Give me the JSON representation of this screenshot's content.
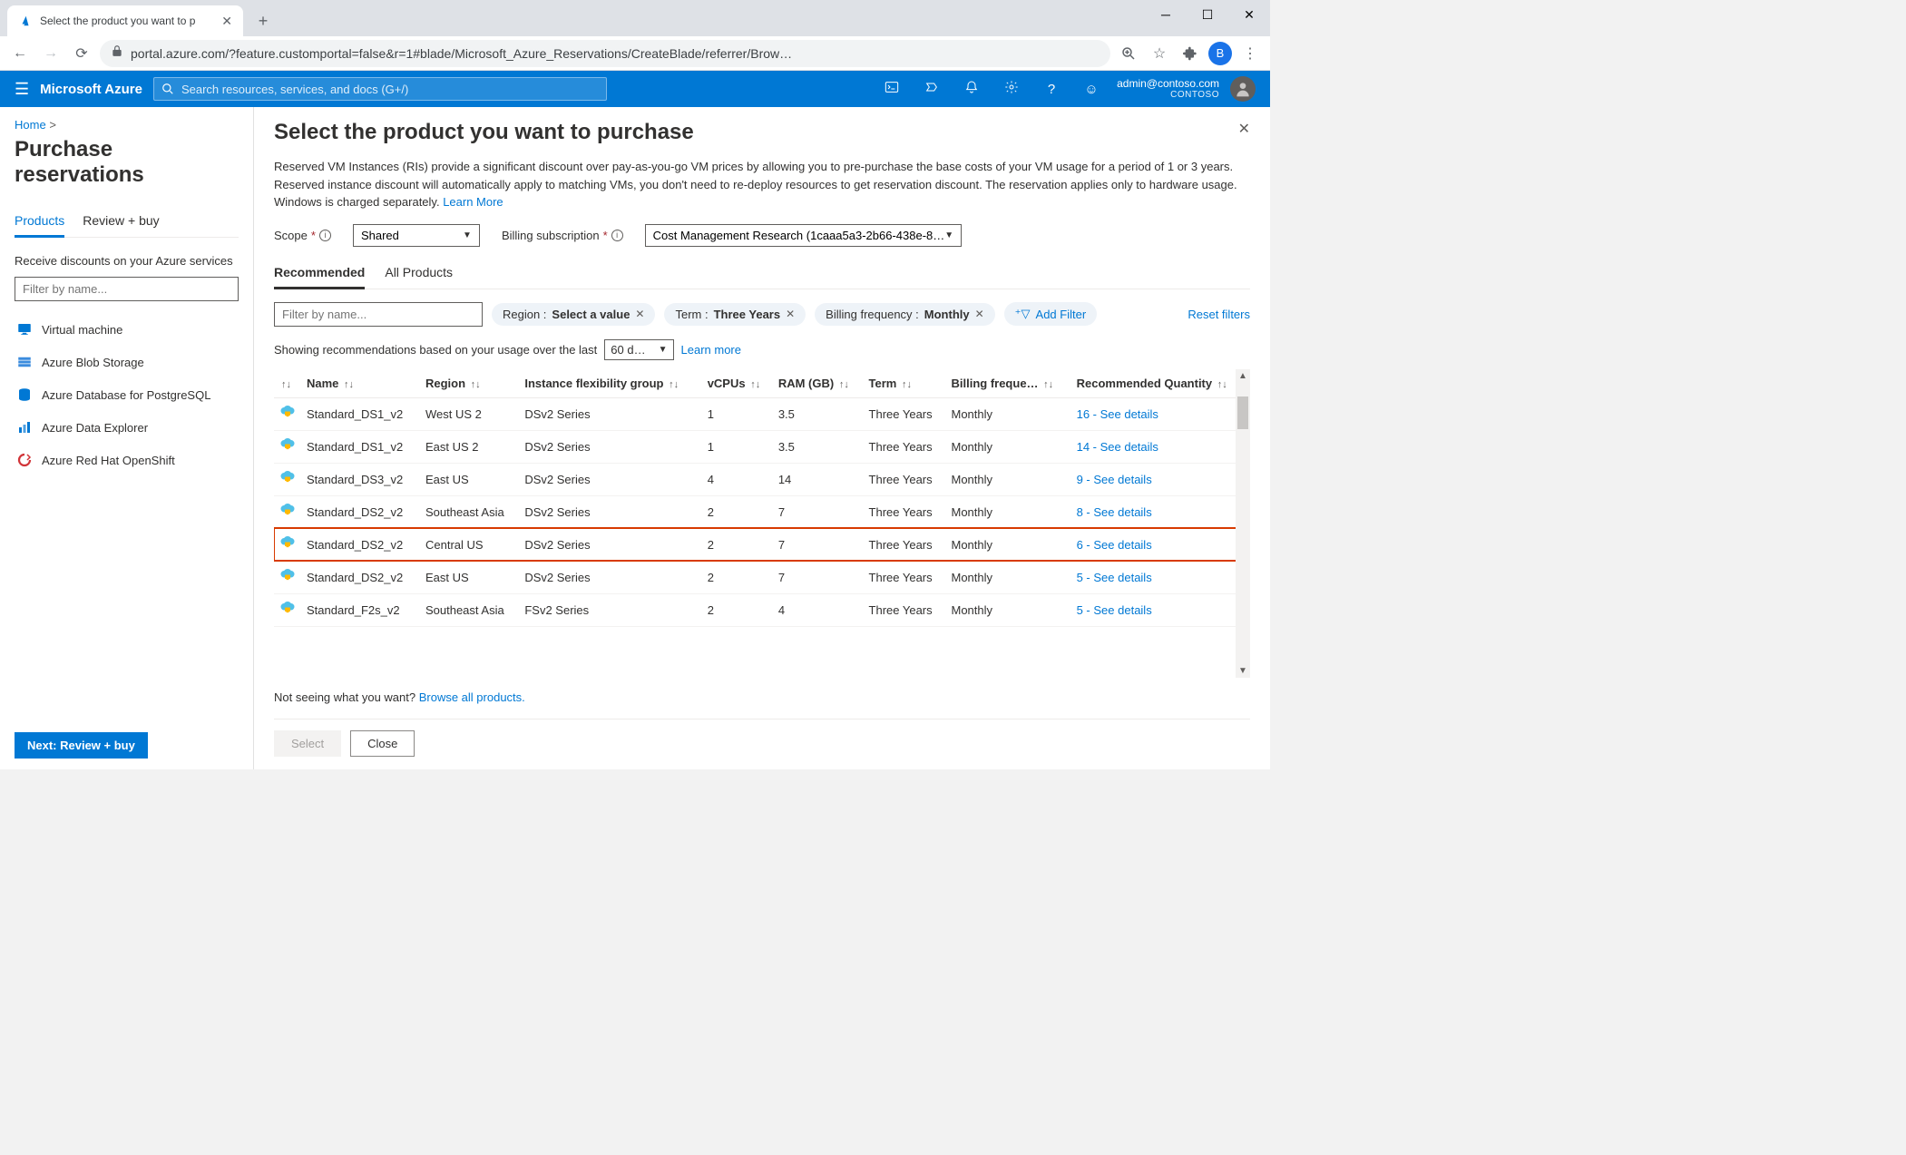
{
  "browser": {
    "tab_title": "Select the product you want to p",
    "url": "portal.azure.com/?feature.customportal=false&r=1#blade/Microsoft_Azure_Reservations/CreateBlade/referrer/Brow…",
    "profile_initial": "B"
  },
  "azure_header": {
    "brand": "Microsoft Azure",
    "search_placeholder": "Search resources, services, and docs (G+/)",
    "user_email": "admin@contoso.com",
    "tenant": "CONTOSO"
  },
  "left": {
    "breadcrumb_home": "Home",
    "title": "Purchase reservations",
    "tabs": {
      "products": "Products",
      "review": "Review + buy"
    },
    "desc": "Receive discounts on your Azure services",
    "filter_placeholder": "Filter by name...",
    "services": [
      "Virtual machine",
      "Azure Blob Storage",
      "Azure Database for PostgreSQL",
      "Azure Data Explorer",
      "Azure Red Hat OpenShift"
    ],
    "review_btn": "Next: Review + buy"
  },
  "blade": {
    "title": "Select the product you want to purchase",
    "desc_text": "Reserved VM Instances (RIs) provide a significant discount over pay-as-you-go VM prices by allowing you to pre-purchase the base costs of your VM usage for a period of 1 or 3 years. Reserved instance discount will automatically apply to matching VMs, you don't need to re-deploy resources to get reservation discount. The reservation applies only to hardware usage. Windows is charged separately. ",
    "learn_more": "Learn More",
    "scope_label": "Scope",
    "scope_value": "Shared",
    "billing_label": "Billing subscription",
    "billing_value": "Cost Management Research (1caaa5a3-2b66-438e-8…",
    "tabs": {
      "recommended": "Recommended",
      "all": "All Products"
    },
    "filter_placeholder": "Filter by name...",
    "pills": {
      "region_label": "Region : ",
      "region_value": "Select a value",
      "term_label": "Term : ",
      "term_value": "Three Years",
      "freq_label": "Billing frequency : ",
      "freq_value": "Monthly",
      "add_filter": "Add Filter"
    },
    "reset_filters": "Reset filters",
    "rec_text": "Showing recommendations based on your usage over the last",
    "rec_period": "60 d…",
    "rec_learn": "Learn more",
    "columns": [
      "Name",
      "Region",
      "Instance flexibility group",
      "vCPUs",
      "RAM (GB)",
      "Term",
      "Billing freque…",
      "Recommended Quantity"
    ],
    "rows": [
      {
        "name": "Standard_DS1_v2",
        "region": "West US 2",
        "flex": "DSv2 Series",
        "vcpus": "1",
        "ram": "3.5",
        "term": "Three Years",
        "freq": "Monthly",
        "qty": "16 - See details",
        "hl": false
      },
      {
        "name": "Standard_DS1_v2",
        "region": "East US 2",
        "flex": "DSv2 Series",
        "vcpus": "1",
        "ram": "3.5",
        "term": "Three Years",
        "freq": "Monthly",
        "qty": "14 - See details",
        "hl": false
      },
      {
        "name": "Standard_DS3_v2",
        "region": "East US",
        "flex": "DSv2 Series",
        "vcpus": "4",
        "ram": "14",
        "term": "Three Years",
        "freq": "Monthly",
        "qty": "9 - See details",
        "hl": false
      },
      {
        "name": "Standard_DS2_v2",
        "region": "Southeast Asia",
        "flex": "DSv2 Series",
        "vcpus": "2",
        "ram": "7",
        "term": "Three Years",
        "freq": "Monthly",
        "qty": "8 - See details",
        "hl": false
      },
      {
        "name": "Standard_DS2_v2",
        "region": "Central US",
        "flex": "DSv2 Series",
        "vcpus": "2",
        "ram": "7",
        "term": "Three Years",
        "freq": "Monthly",
        "qty": "6 - See details",
        "hl": true
      },
      {
        "name": "Standard_DS2_v2",
        "region": "East US",
        "flex": "DSv2 Series",
        "vcpus": "2",
        "ram": "7",
        "term": "Three Years",
        "freq": "Monthly",
        "qty": "5 - See details",
        "hl": false
      },
      {
        "name": "Standard_F2s_v2",
        "region": "Southeast Asia",
        "flex": "FSv2 Series",
        "vcpus": "2",
        "ram": "4",
        "term": "Three Years",
        "freq": "Monthly",
        "qty": "5 - See details",
        "hl": false
      }
    ],
    "not_seeing": "Not seeing what you want? ",
    "browse_all": "Browse all products.",
    "select_btn": "Select",
    "close_btn": "Close"
  }
}
